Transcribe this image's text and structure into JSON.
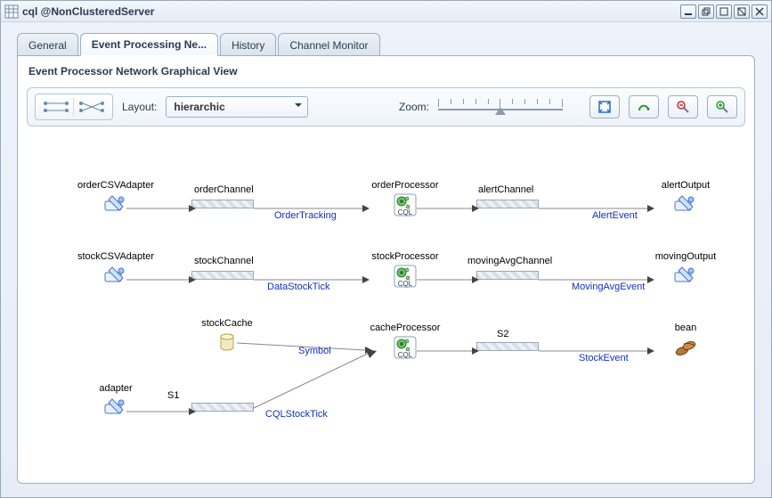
{
  "window": {
    "title": "cql @NonClusteredServer",
    "buttons": [
      "minimize",
      "restore",
      "maximize",
      "close-all",
      "close"
    ]
  },
  "tabs": [
    {
      "label": "General",
      "active": false
    },
    {
      "label": "Event Processing Ne...",
      "active": true
    },
    {
      "label": "History",
      "active": false
    },
    {
      "label": "Channel Monitor",
      "active": false
    }
  ],
  "panel": {
    "title": "Event Processor Network Graphical View"
  },
  "toolbar": {
    "layout_label": "Layout:",
    "layout_value": "hierarchic",
    "zoom_label": "Zoom:",
    "buttons": [
      "fit-window",
      "toggle-layout",
      "zoom-out",
      "zoom-in"
    ]
  },
  "network": {
    "nodes": {
      "orderCSVAdapter": {
        "label": "orderCSVAdapter",
        "type": "adapter"
      },
      "orderProcessor": {
        "label": "orderProcessor",
        "type": "cql"
      },
      "alertOutput": {
        "label": "alertOutput",
        "type": "adapter"
      },
      "stockCSVAdapter": {
        "label": "stockCSVAdapter",
        "type": "adapter"
      },
      "stockProcessor": {
        "label": "stockProcessor",
        "type": "cql"
      },
      "movingOutput": {
        "label": "movingOutput",
        "type": "adapter"
      },
      "stockCache": {
        "label": "stockCache",
        "type": "cache"
      },
      "cacheProcessor": {
        "label": "cacheProcessor",
        "type": "cql"
      },
      "bean": {
        "label": "bean",
        "type": "bean"
      },
      "adapter": {
        "label": "adapter",
        "type": "adapter"
      }
    },
    "channels": {
      "orderChannel": {
        "label": "orderChannel",
        "event": "OrderTracking"
      },
      "alertChannel": {
        "label": "alertChannel",
        "event": "AlertEvent"
      },
      "stockChannel": {
        "label": "stockChannel",
        "event": "DataStockTick"
      },
      "movingAvgChannel": {
        "label": "movingAvgChannel",
        "event": "MovingAvgEvent"
      },
      "symbol": {
        "label": "",
        "event": "Symbol"
      },
      "s2": {
        "label": "S2",
        "event": "StockEvent"
      },
      "s1": {
        "label": "S1",
        "event": "CQLStockTick"
      }
    }
  }
}
